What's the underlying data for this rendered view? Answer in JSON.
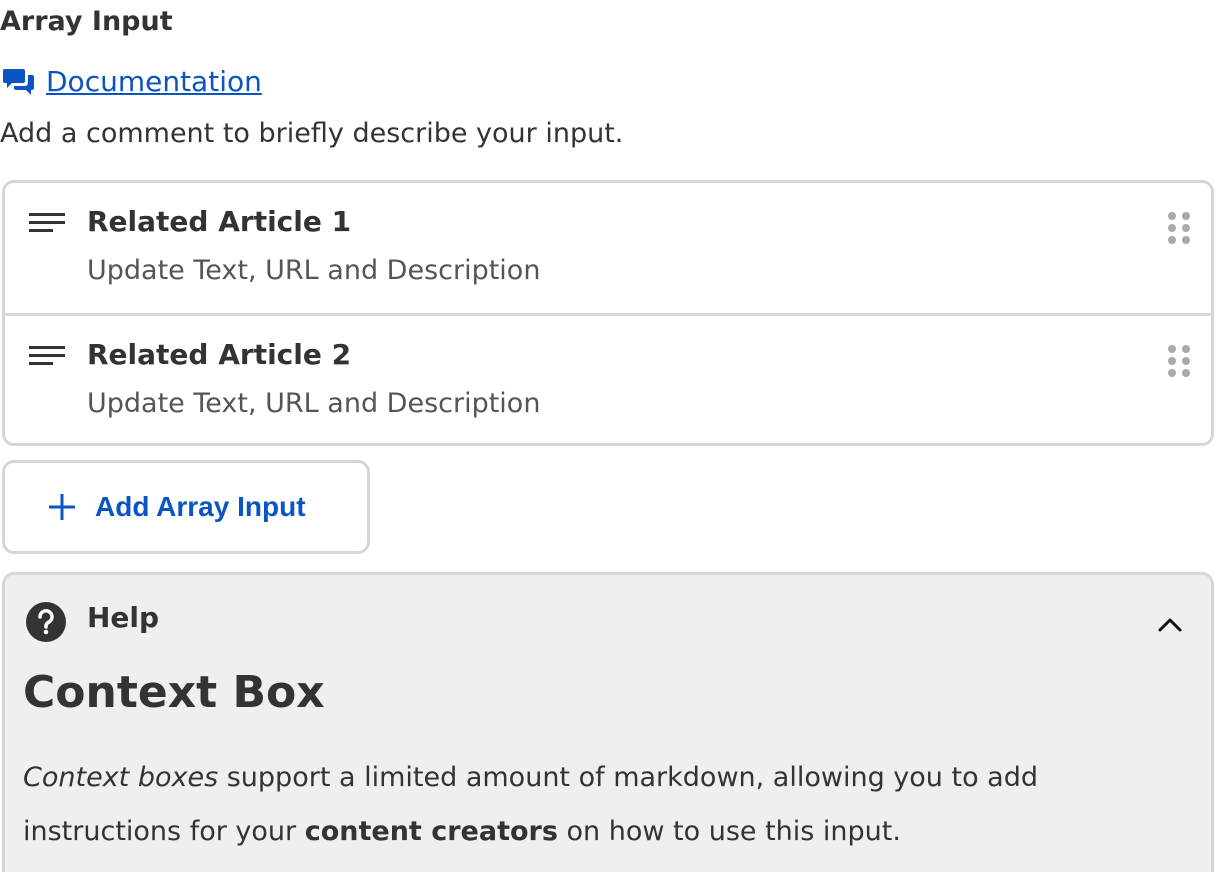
{
  "field": {
    "title": "Array Input",
    "documentation_label": "Documentation",
    "subtitle": "Add a comment to briefly describe your input."
  },
  "array_items": [
    {
      "title": "Related Article 1",
      "description": "Update Text, URL and Description"
    },
    {
      "title": "Related Article 2",
      "description": "Update Text, URL and Description"
    }
  ],
  "add_button": {
    "label": "Add Array Input"
  },
  "help": {
    "label": "Help",
    "heading": "Context Box",
    "body_part1_italic": "Context boxes",
    "body_part2": " support a limited amount of markdown, allowing you to add instructions for your ",
    "body_part3_bold": "content creators",
    "body_part4": " on how to use this input."
  },
  "colors": {
    "link_blue": "#0a55c2",
    "border_gray": "#d6d6d6",
    "help_background": "#efefef",
    "text_dark": "#333333"
  },
  "icons": {
    "documentation": "chat-bubbles-icon",
    "item": "text-lines-icon",
    "drag": "drag-handle-icon",
    "add": "plus-icon",
    "help": "question-circle-icon",
    "collapse": "chevron-up-icon"
  }
}
